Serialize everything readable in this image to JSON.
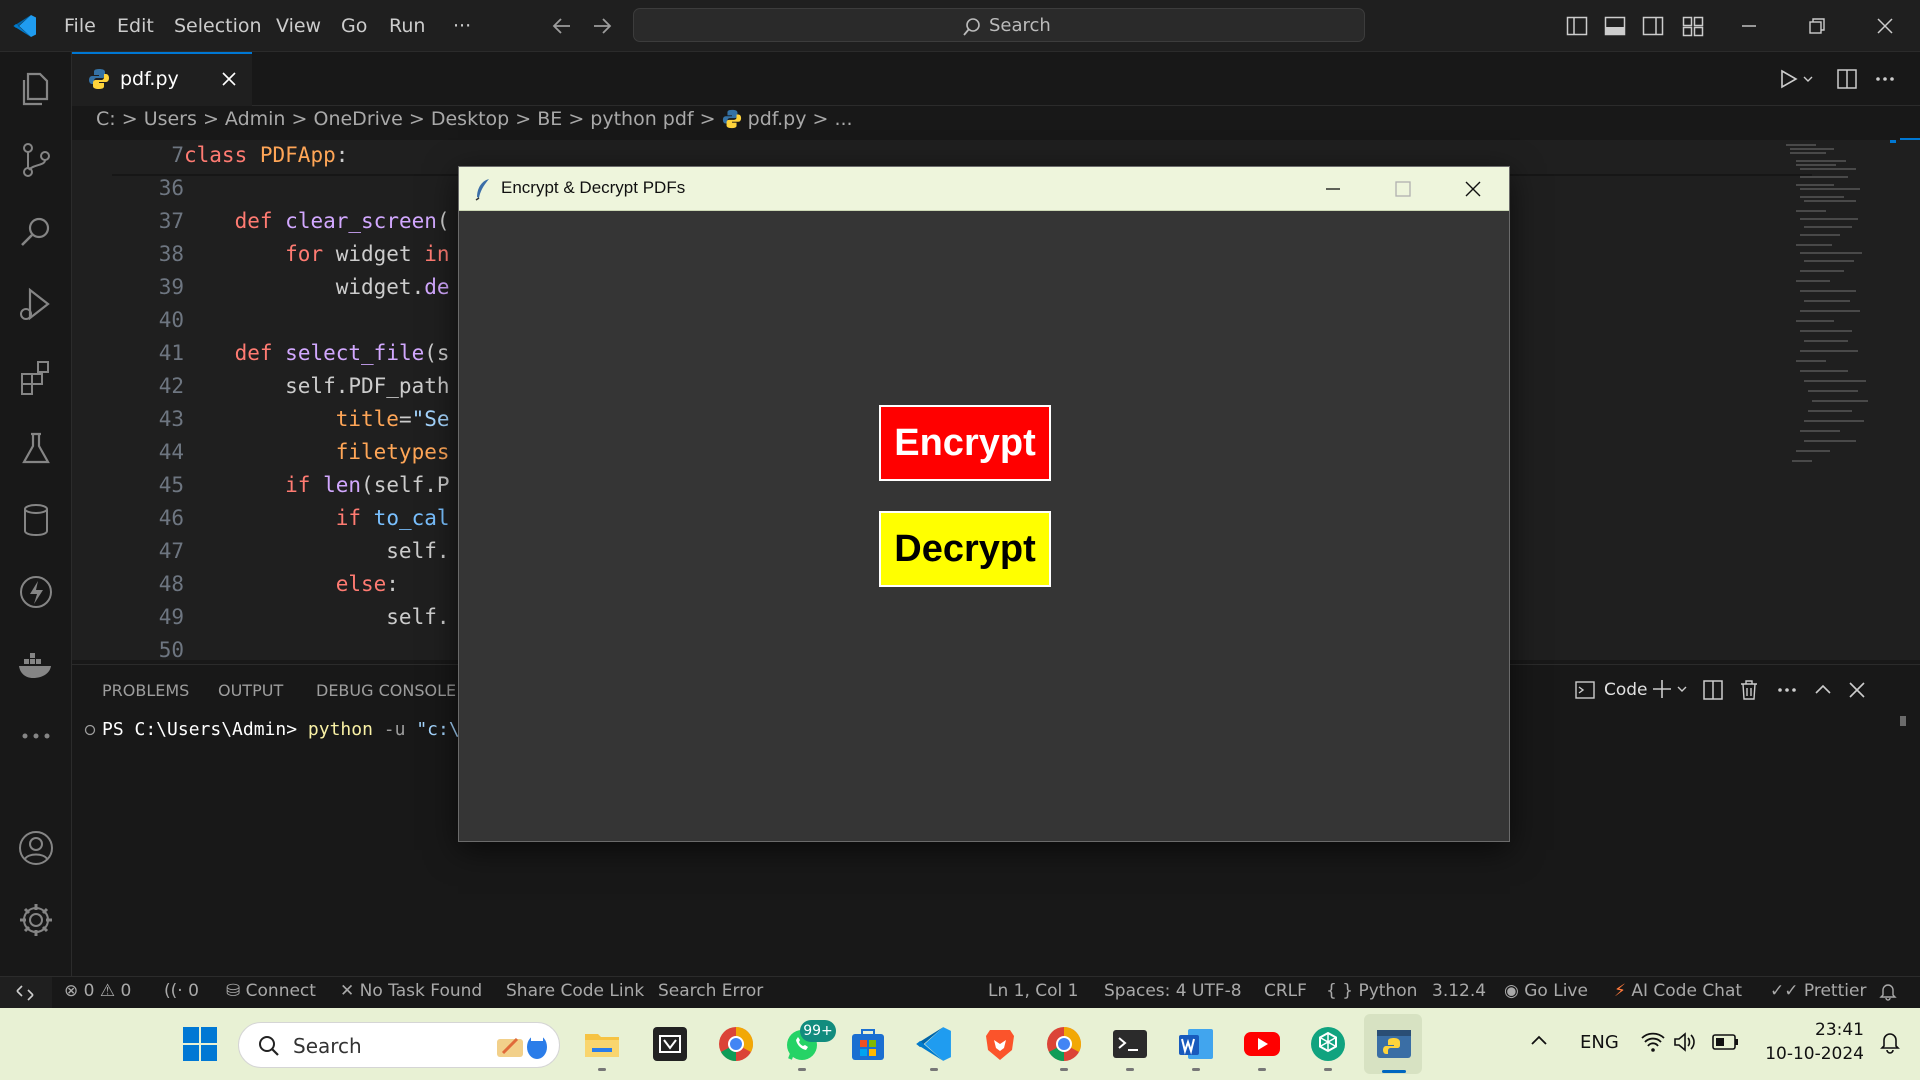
{
  "menu": [
    "File",
    "Edit",
    "Selection",
    "View",
    "Go",
    "Run",
    "···"
  ],
  "search": {
    "label": "Search"
  },
  "tab": {
    "name": "pdf.py"
  },
  "breadcrumb": [
    "C:",
    ">",
    "Users",
    ">",
    "Admin",
    ">",
    "OneDrive",
    ">",
    "Desktop",
    ">",
    "BE",
    ">",
    "python pdf",
    ">",
    "pdf.py",
    ">",
    "..."
  ],
  "editor": {
    "lines": [
      {
        "n": "7",
        "code": "class PDFApp:"
      },
      {
        "n": "36",
        "code": ""
      },
      {
        "n": "37",
        "code": "    def clear_screen("
      },
      {
        "n": "38",
        "code": "        for widget in"
      },
      {
        "n": "39",
        "code": "            widget.de"
      },
      {
        "n": "40",
        "code": ""
      },
      {
        "n": "41",
        "code": "    def select_file(s"
      },
      {
        "n": "42",
        "code": "        self.PDF_path"
      },
      {
        "n": "43",
        "code": "            title=\"Se"
      },
      {
        "n": "44",
        "code": "            filetypes"
      },
      {
        "n": "45",
        "code": "        if len(self.P"
      },
      {
        "n": "46",
        "code": "            if to_cal"
      },
      {
        "n": "47",
        "code": "                self."
      },
      {
        "n": "48",
        "code": "            else:"
      },
      {
        "n": "49",
        "code": "                self."
      },
      {
        "n": "50",
        "code": ""
      }
    ]
  },
  "panel": {
    "tabs": [
      "PROBLEMS",
      "OUTPUT",
      "DEBUG CONSOLE"
    ],
    "terminal_name": "Code",
    "prompt": "PS C:\\Users\\Admin>",
    "command": "python",
    "arg": "-u",
    "path": "\"c:\\"
  },
  "status": {
    "errors": "0",
    "warnings": "0",
    "ports": "0",
    "connect": "Connect",
    "task": "No Task Found",
    "share": "Share Code Link",
    "search_error": "Search Error",
    "position": "Ln 1, Col 1",
    "spaces": "Spaces: 4",
    "encoding": "UTF-8",
    "eol": "CRLF",
    "language": "Python",
    "version": "3.12.4",
    "golive": "Go Live",
    "aichat": "AI Code Chat",
    "prettier": "Prettier"
  },
  "dialog": {
    "title": "Encrypt & Decrypt PDFs",
    "encrypt_label": "Encrypt",
    "decrypt_label": "Decrypt",
    "encrypt_color": "#ff0000",
    "decrypt_color": "#ffff00"
  },
  "taskbar": {
    "search_label": "Search",
    "whatsapp_badge": "99+",
    "lang": "ENG",
    "time": "23:41",
    "date": "10-10-2024"
  }
}
